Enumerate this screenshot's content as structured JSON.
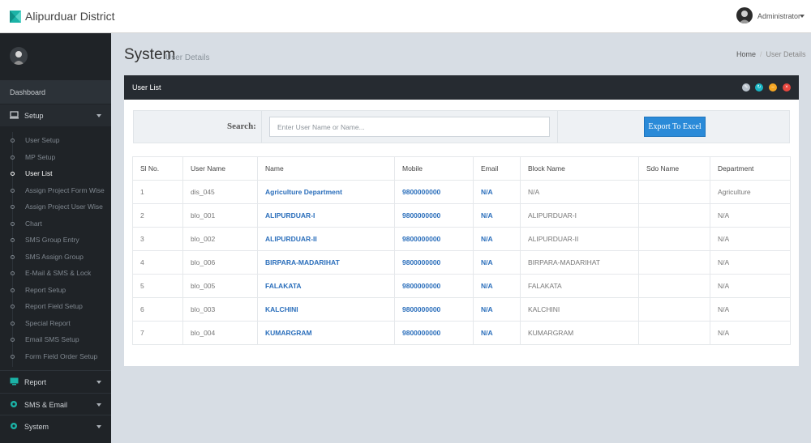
{
  "app": {
    "title": "Alipurduar District"
  },
  "user": {
    "name": "Administrator"
  },
  "sidebar": {
    "dashboard": "Dashboard",
    "setup": {
      "label": "Setup",
      "items": [
        "User Setup",
        "MP Setup",
        "User List",
        "Assign Project Form Wise",
        "Assign Project User Wise",
        "Chart",
        "SMS Group Entry",
        "SMS Assign Group",
        "E-Mail & SMS & Lock",
        "Report Setup",
        "Report Field Setup",
        "Special Report",
        "Email SMS Setup",
        "Form Field Order Setup"
      ],
      "active_item": "User List"
    },
    "report": "Report",
    "sms_email": "SMS & Email",
    "system": "System"
  },
  "page": {
    "title": "System",
    "subtitle": "User Details",
    "breadcrumb": {
      "home": "Home",
      "current": "User Details"
    }
  },
  "panel": {
    "title": "User List",
    "search_label": "Search:",
    "search_placeholder": "Enter User Name or Name...",
    "search_value": "",
    "export_label": "Export To Excel",
    "colors": {
      "btn1": "#b9c2cb",
      "btn2": "#19b5c3",
      "btn3": "#f5a623",
      "btn4": "#e8473f"
    }
  },
  "table": {
    "columns": [
      "Sl No.",
      "User Name",
      "Name",
      "Mobile",
      "Email",
      "Block Name",
      "Sdo Name",
      "Department"
    ],
    "rows": [
      [
        "1",
        "dis_045",
        "Agriculture Department",
        "9800000000",
        "N/A",
        "N/A",
        "",
        "Agriculture"
      ],
      [
        "2",
        "blo_001",
        "ALIPURDUAR-I",
        "9800000000",
        "N/A",
        "ALIPURDUAR-I",
        "",
        "N/A"
      ],
      [
        "3",
        "blo_002",
        "ALIPURDUAR-II",
        "9800000000",
        "N/A",
        "ALIPURDUAR-II",
        "",
        "N/A"
      ],
      [
        "4",
        "blo_006",
        "BIRPARA-MADARIHAT",
        "9800000000",
        "N/A",
        "BIRPARA-MADARIHAT",
        "",
        "N/A"
      ],
      [
        "5",
        "blo_005",
        "FALAKATA",
        "9800000000",
        "N/A",
        "FALAKATA",
        "",
        "N/A"
      ],
      [
        "6",
        "blo_003",
        "KALCHINI",
        "9800000000",
        "N/A",
        "KALCHINI",
        "",
        "N/A"
      ],
      [
        "7",
        "blo_004",
        "KUMARGRAM",
        "9800000000",
        "N/A",
        "KUMARGRAM",
        "",
        "N/A"
      ]
    ]
  }
}
